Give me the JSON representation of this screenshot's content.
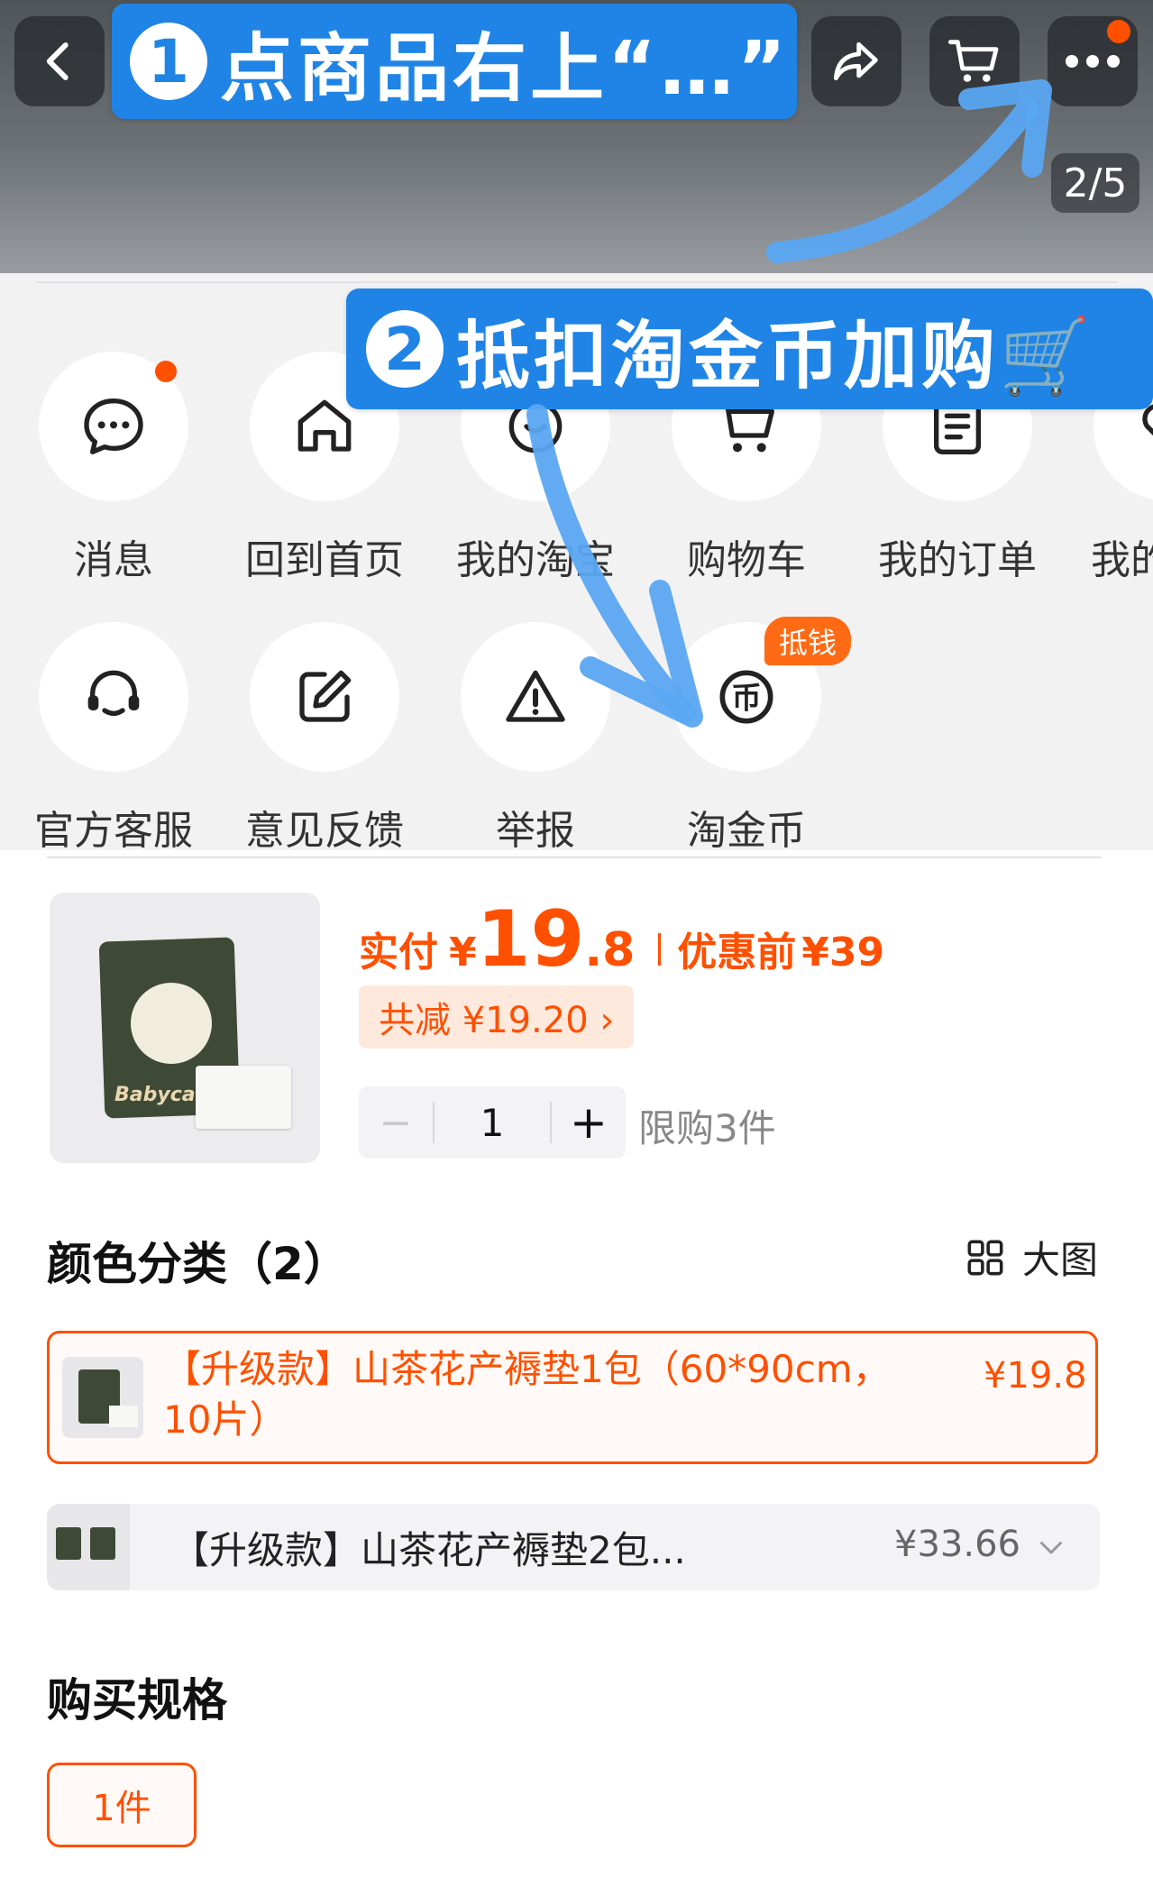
{
  "header": {
    "back_icon": "chevron-left-icon",
    "share_icon": "share-icon",
    "cart_icon": "cart-icon",
    "more_icon": "more-dots-icon",
    "page_indicator": "2/5"
  },
  "annotations": {
    "step1": {
      "number": "1",
      "text": "点商品右上“…”"
    },
    "step2": {
      "number": "2",
      "text": "抵扣淘金币加购🛒"
    }
  },
  "menu": {
    "row1": [
      {
        "label": "消息",
        "icon": "message-icon"
      },
      {
        "label": "回到首页",
        "icon": "home-icon"
      },
      {
        "label": "我的淘宝",
        "icon": "taobao-icon"
      },
      {
        "label": "购物车",
        "icon": "cart-icon"
      },
      {
        "label": "我的订单",
        "icon": "order-icon"
      },
      {
        "label": "我的",
        "icon": "favorite-icon"
      }
    ],
    "row2": [
      {
        "label": "官方客服",
        "icon": "headset-icon"
      },
      {
        "label": "意见反馈",
        "icon": "edit-icon"
      },
      {
        "label": "举报",
        "icon": "warning-icon"
      },
      {
        "label": "淘金币",
        "icon": "coin-icon",
        "badge": "抵钱"
      }
    ]
  },
  "product": {
    "pay_label": "实付",
    "currency": "¥",
    "price_int": "19",
    "price_dec": ".8",
    "original_label": "优惠前",
    "original_price": "¥39",
    "discount_text": "共减 ¥19.20 ›",
    "quantity": "1",
    "minus": "−",
    "plus": "+",
    "limit_text": "限购3件",
    "image_brand": "Babycare"
  },
  "variants": {
    "title": "颜色分类（2）",
    "view_toggle": "大图",
    "items": [
      {
        "name": "【升级款】山茶花产褥垫1包（60*90cm，10片）",
        "price": "¥19.8",
        "selected": true
      },
      {
        "name": "【升级款】山茶花产褥垫2包...",
        "price": "¥33.66",
        "selected": false
      }
    ]
  },
  "spec": {
    "title": "购买规格",
    "options": [
      "1件"
    ]
  },
  "colors": {
    "accent": "#ff5000",
    "callout": "#1f84e6"
  }
}
